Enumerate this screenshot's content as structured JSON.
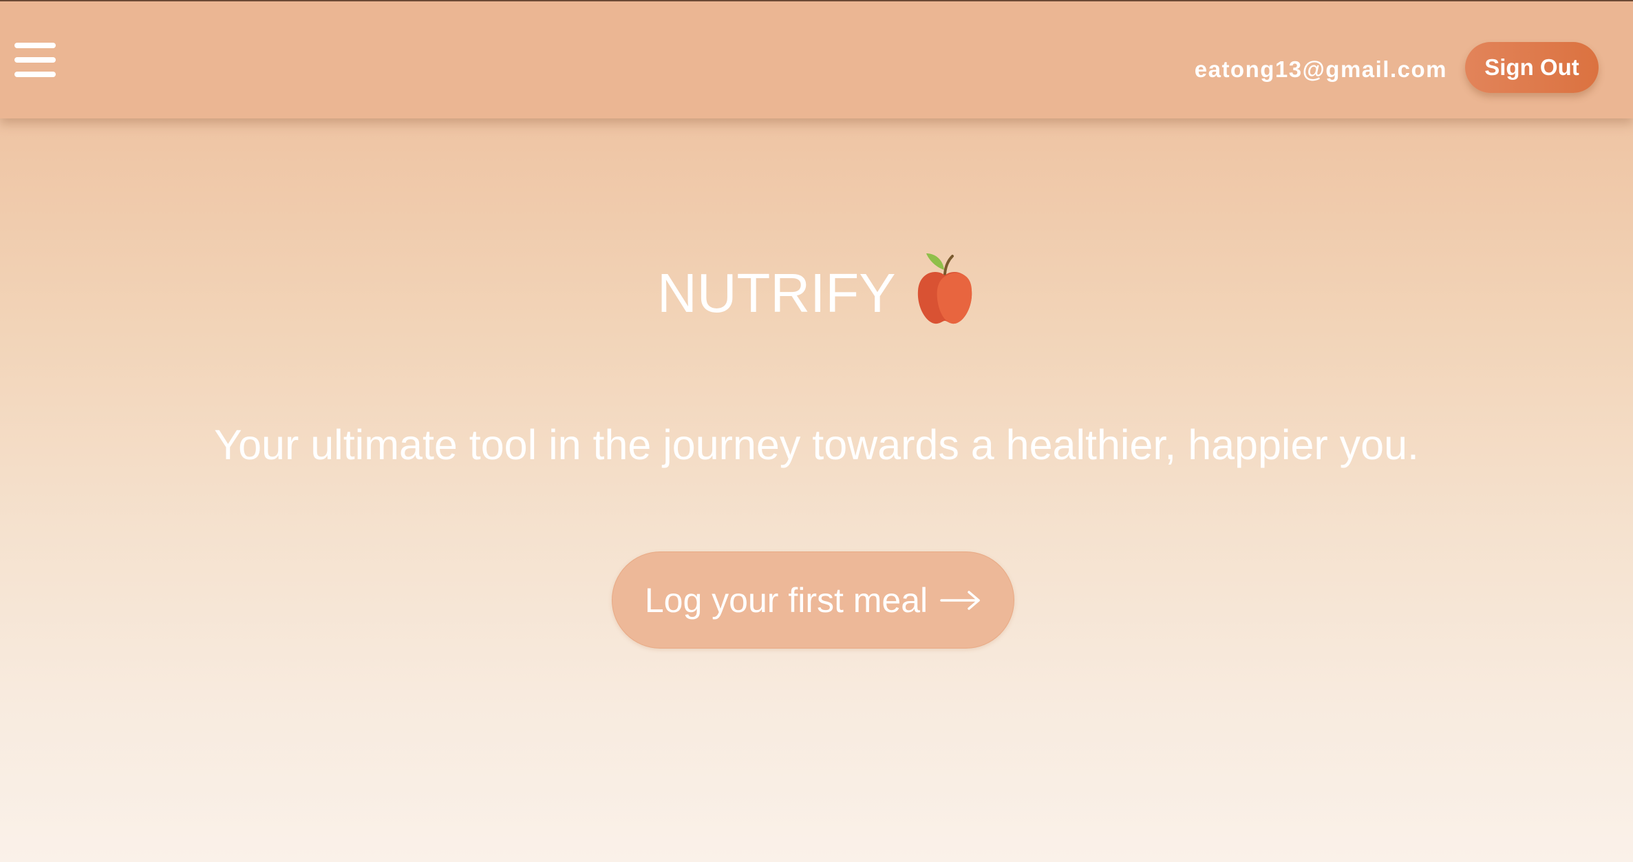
{
  "header": {
    "menu_icon": "hamburger-menu-icon",
    "user_email": "eatong13@gmail.com",
    "sign_out_label": "Sign Out"
  },
  "hero": {
    "title": "NUTRIFY",
    "title_icon": "apple-icon",
    "tagline": "Your ultimate tool in the journey towards a healthier, happier you.",
    "cta_label": "Log your first meal",
    "cta_icon": "arrow-right-icon"
  },
  "colors": {
    "header_background": "#ebb693",
    "sign_out_button": "#dd7a4c",
    "cta_button": "#edb898",
    "text": "#ffffff",
    "apple_red": "#e5603c",
    "leaf_green": "#8fbf4a"
  }
}
